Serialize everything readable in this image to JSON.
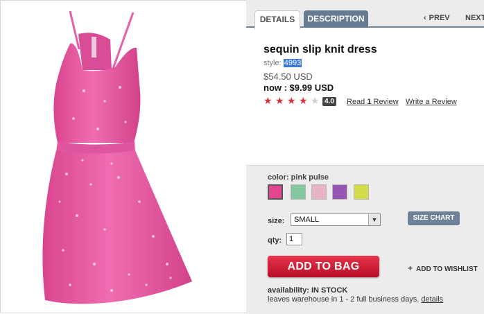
{
  "tabs": {
    "details": "DETAILS",
    "description": "DESCRIPTION"
  },
  "nav": {
    "prev": "PREV",
    "next": "NEXT",
    "prev_icon": "chevron-left-icon"
  },
  "product": {
    "title": "sequin slip knit dress",
    "style_label": "style:",
    "style_number": "4993",
    "original_price": "$54.50 USD",
    "now_price": "now : $9.99 USD",
    "rating": {
      "value": 4.0,
      "label": "4.0",
      "max": 5
    },
    "read_review": {
      "prefix": "Read ",
      "count": "1",
      "suffix": " Review"
    },
    "write_review": "Write a Review"
  },
  "options": {
    "color_label": "color: pink pulse",
    "swatches": [
      {
        "name": "pink pulse",
        "color": "#e2468f",
        "selected": true
      },
      {
        "name": "mint",
        "color": "#83c7a1",
        "selected": false
      },
      {
        "name": "light pink",
        "color": "#e6b4c4",
        "selected": false
      },
      {
        "name": "purple",
        "color": "#9656b4",
        "selected": false
      },
      {
        "name": "lime",
        "color": "#d3dc4a",
        "selected": false
      }
    ],
    "size_label": "size:",
    "size_value": "SMALL",
    "size_chart": "SIZE CHART",
    "qty_label": "qty:",
    "qty_value": "1",
    "add_to_bag": "ADD TO BAG",
    "add_to_wishlist": "ADD TO WISHLIST",
    "availability": "availability: IN STOCK",
    "leaves_text": "leaves warehouse in 1 - 2 full business days.",
    "details_link": "details"
  },
  "colors": {
    "tab_active_bg": "#657b92",
    "add_to_bag": "#d0233a",
    "star_on": "#d6303b",
    "dress": "#e85fa8"
  }
}
